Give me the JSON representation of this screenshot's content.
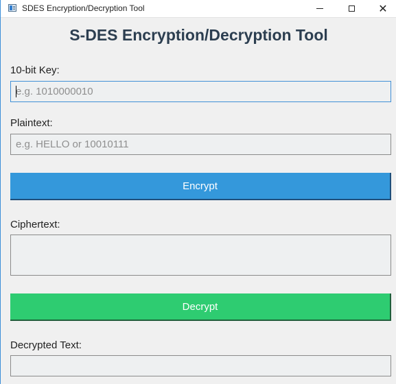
{
  "window": {
    "title": "SDES Encryption/Decryption Tool",
    "controls": {
      "minimize": "minimize",
      "maximize": "maximize",
      "close": "close"
    }
  },
  "main": {
    "heading": "S-DES Encryption/Decryption Tool",
    "key": {
      "label": "10-bit Key:",
      "value": "",
      "placeholder": "e.g. 1010000010"
    },
    "plaintext": {
      "label": "Plaintext:",
      "value": "",
      "placeholder": "e.g. HELLO or 10010111"
    },
    "encrypt_button": "Encrypt",
    "ciphertext": {
      "label": "Ciphertext:",
      "value": ""
    },
    "decrypt_button": "Decrypt",
    "decrypted": {
      "label": "Decrypted Text:",
      "value": ""
    }
  },
  "colors": {
    "heading": "#2c3e50",
    "encrypt_button": "#3498db",
    "decrypt_button": "#2ecc71",
    "focus_border": "#3f8fd6"
  },
  "icons": {
    "app": "app-window-icon",
    "minimize": "minimize-icon",
    "maximize": "maximize-icon",
    "close": "close-icon"
  }
}
